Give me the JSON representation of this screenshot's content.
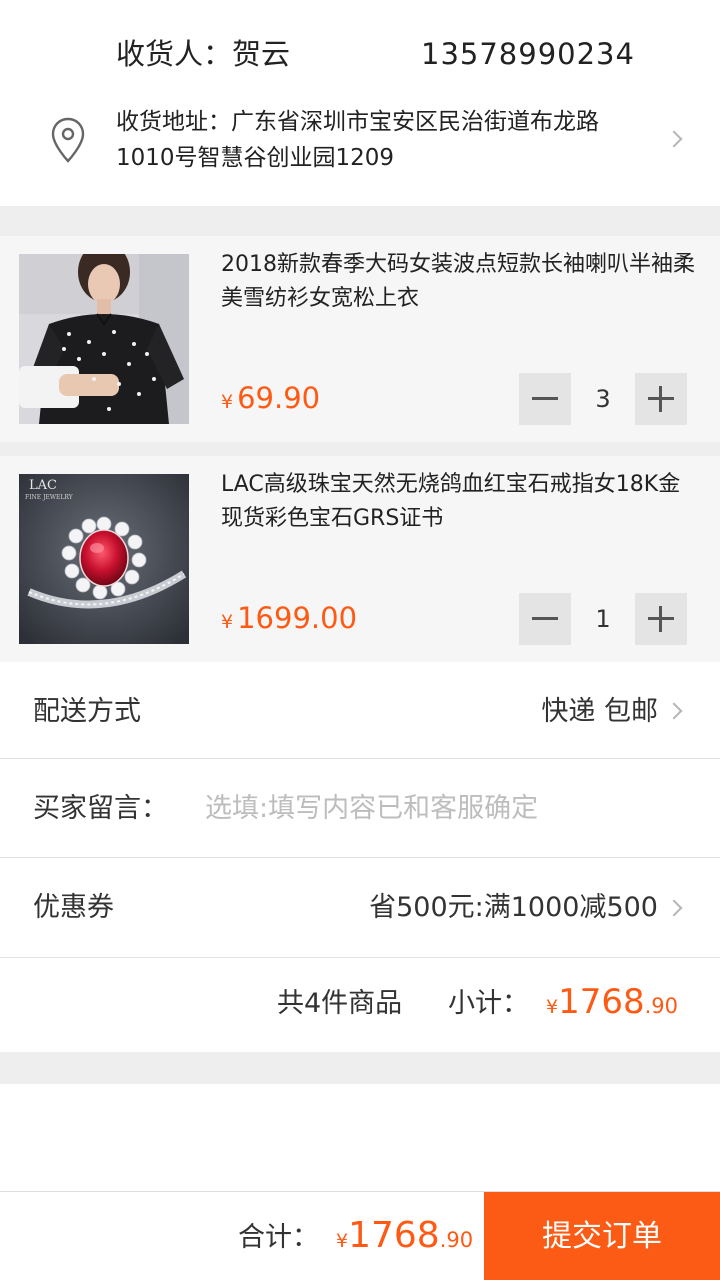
{
  "receiver": {
    "label": "收货人：",
    "name": "贺云",
    "phone": "13578990234",
    "address_label": "收货地址：",
    "address": "广东省深圳市宝安区民治街道布龙路1010号智慧谷创业园1209",
    "icon": "location-pin-icon"
  },
  "products": [
    {
      "title": "2018新款春季大码女装波点短款长袖喇叭半袖柔美雪纺衫女宽松上衣",
      "currency": "¥",
      "price": "69.90",
      "quantity": "3",
      "image": "polka-dot-blouse-photo"
    },
    {
      "title": "LAC高级珠宝天然无烧鸽血红宝石戒指女18K金现货彩色宝石GRS证书",
      "currency": "¥",
      "price": "1699.00",
      "quantity": "1",
      "image": "ruby-ring-photo",
      "brand_text": "LAC",
      "brand_sub": "FINE JEWELRY"
    }
  ],
  "delivery": {
    "label": "配送方式",
    "value": "快递 包邮"
  },
  "message": {
    "label": "买家留言：",
    "placeholder": "选填:填写内容已和客服确定"
  },
  "coupon": {
    "label": "优惠券",
    "value": "省500元:满1000减500"
  },
  "subtotal": {
    "count_text": "共4件商品",
    "label": "小计：",
    "currency": "¥",
    "integer": "1768",
    "decimal": ".90"
  },
  "footer": {
    "total_label": "合计：",
    "currency": "¥",
    "integer": "1768",
    "decimal": ".90",
    "submit_label": "提交订单"
  },
  "colors": {
    "accent": "#fb5b14",
    "price": "#ff5a14",
    "background_gap": "#eeeeee",
    "product_bg": "#f6f6f6"
  }
}
